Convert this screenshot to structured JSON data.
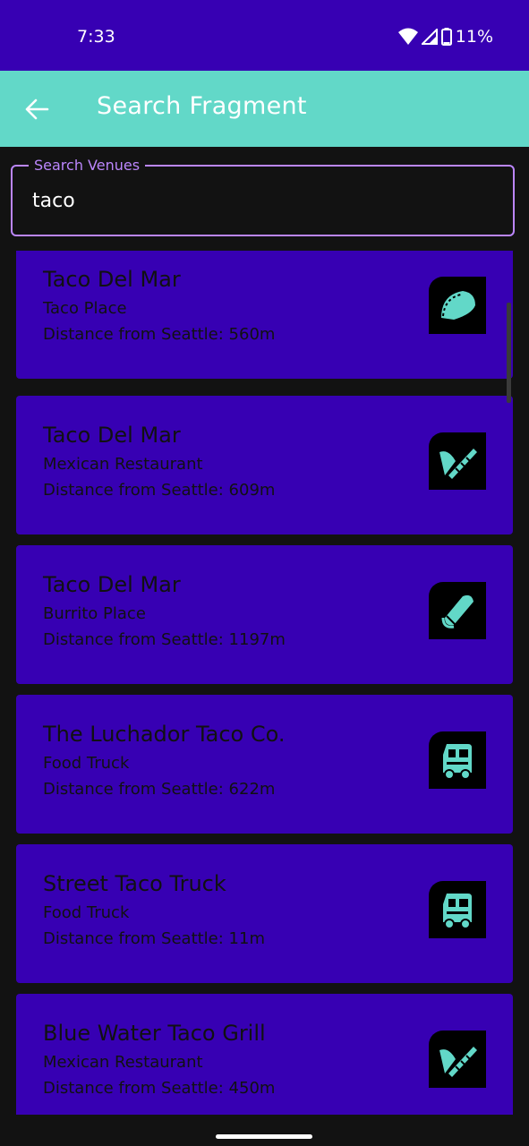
{
  "status_bar": {
    "time": "7:33",
    "battery": "11%"
  },
  "app_bar": {
    "title": "Search Fragment"
  },
  "search": {
    "label": "Search Venues",
    "value": "taco"
  },
  "venues": [
    {
      "name": "Taco Del Mar",
      "category": "Taco Place",
      "distance": "Distance from Seattle: 560m",
      "icon": "taco-icon"
    },
    {
      "name": "Taco Del Mar",
      "category": "Mexican Restaurant",
      "distance": "Distance from Seattle: 609m",
      "icon": "mexican-food-icon"
    },
    {
      "name": "Taco Del Mar",
      "category": "Burrito Place",
      "distance": "Distance from Seattle: 1197m",
      "icon": "burrito-icon"
    },
    {
      "name": "The Luchador Taco Co.",
      "category": "Food Truck",
      "distance": "Distance from Seattle: 622m",
      "icon": "food-truck-icon"
    },
    {
      "name": "Street Taco Truck",
      "category": "Food Truck",
      "distance": "Distance from Seattle: 11m",
      "icon": "food-truck-icon"
    },
    {
      "name": "Blue Water Taco Grill",
      "category": "Mexican Restaurant",
      "distance": "Distance from Seattle: 450m",
      "icon": "mexican-food-icon"
    }
  ],
  "colors": {
    "status_bar": "#3700b3",
    "app_bar": "#62d8c8",
    "accent": "#bb86fc",
    "card": "#3700b3",
    "icon": "#62d8c8",
    "background": "#121212"
  }
}
